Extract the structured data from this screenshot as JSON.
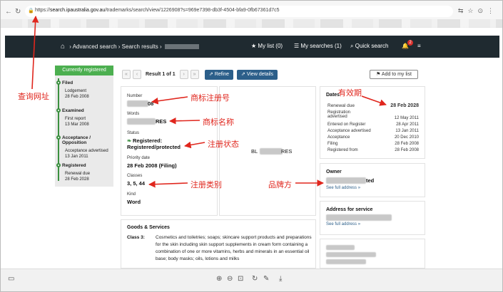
{
  "browser": {
    "url_prefix": "https://",
    "url_host": "search.ipaustralia.gov.au",
    "url_path": "/trademarks/search/view/1226908?s=969e7398-db3f-4504-bfa9-0fb67361d7c5"
  },
  "header": {
    "breadcrumb_advanced": "Advanced search",
    "breadcrumb_results": "Search results",
    "my_list": "My list (0)",
    "my_searches": "My searches (1)",
    "quick_search": "Quick search",
    "notification_count": "2"
  },
  "status": {
    "heading": "Currently registered",
    "steps": [
      {
        "title": "Filed",
        "lines": [
          "Lodgement",
          "28 Feb 2008"
        ]
      },
      {
        "title": "Examined",
        "lines": [
          "First report",
          "13 Mar 2008"
        ]
      },
      {
        "title": "Acceptance / Opposition",
        "lines": [
          "Acceptance advertised",
          "13 Jan 2011"
        ]
      },
      {
        "title": "Registered",
        "lines": [
          "Renewal due",
          "28 Feb 2028"
        ]
      }
    ]
  },
  "toolbar": {
    "result_text": "Result 1 of 1",
    "refine": "Refine",
    "view_details": "View details",
    "add_to_list": "Add to my list"
  },
  "details": {
    "number_label": "Number",
    "number_value": "08",
    "words_label": "Words",
    "words_value": "RES",
    "status_label": "Status",
    "status_value_1": "Registered:",
    "status_value_2": "Registered/protected",
    "priority_label": "Priority date",
    "priority_value": "28 Feb 2008 (Filing)",
    "classes_label": "Classes",
    "classes_value": "3, 5, 44",
    "kind_label": "Kind",
    "kind_value": "Word",
    "image_text_left": "BL",
    "image_text_right": "RES"
  },
  "dates": {
    "heading": "Dates",
    "renewal_label": "Renewal due",
    "renewal_value": "28 Feb 2028",
    "rows": [
      {
        "label": "Registration",
        "label2": "advertised",
        "value": "12 May 2011"
      },
      {
        "label": "Entered on Register",
        "value": "28 Apr 2011"
      },
      {
        "label": "Acceptance advertised",
        "value": "13 Jan 2011"
      },
      {
        "label": "Acceptance",
        "value": "20 Dec 2010"
      },
      {
        "label": "Filing",
        "value": "28 Feb 2008"
      },
      {
        "label": "Registered from",
        "value": "28 Feb 2008"
      }
    ]
  },
  "owner": {
    "heading": "Owner",
    "name_tail": "ted",
    "link": "See full address »"
  },
  "service": {
    "heading": "Address for service",
    "link": "See full address »"
  },
  "goods": {
    "heading": "Goods & Services",
    "class_label": "Class 3:",
    "text": "Cosmetics and toiletries; soaps; skincare support products and preparations for the skin including skin support supplements in cream form containing a combination of one or more vitamins, herbs and minerals in an essential oil base; body masks; oils, lotions and milks"
  },
  "annotations": {
    "url": "查询网址",
    "number": "商标注册号",
    "name": "商标名称",
    "status": "注册状态",
    "classes": "注册类别",
    "validity": "有效期",
    "owner": "品牌方"
  },
  "colors": {
    "header_bg": "#1f2a30",
    "status_green": "#4caf50",
    "button_blue": "#2c5f8a",
    "annotation_red": "#e0261d"
  }
}
